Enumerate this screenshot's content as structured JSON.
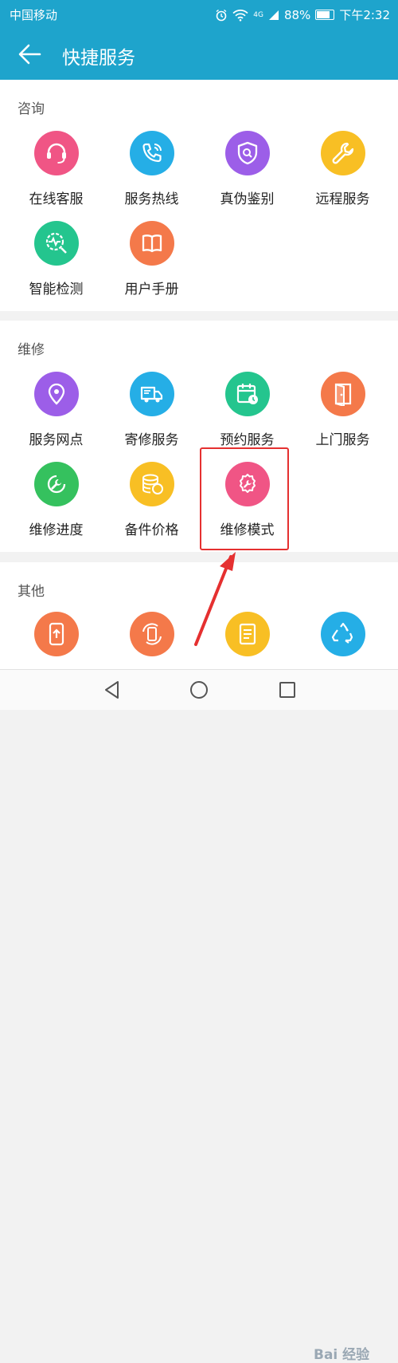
{
  "status_bar": {
    "carrier": "中国移动",
    "network": "4G",
    "battery": "88%",
    "battery_level": 0.88,
    "time": "下午2:32"
  },
  "header": {
    "title": "快捷服务"
  },
  "sections": [
    {
      "title": "咨询",
      "items": [
        {
          "label": "在线客服",
          "icon": "headset-icon",
          "color": "#f05585"
        },
        {
          "label": "服务热线",
          "icon": "phone-icon",
          "color": "#25aee6"
        },
        {
          "label": "真伪鉴别",
          "icon": "shield-search-icon",
          "color": "#9c5ee8"
        },
        {
          "label": "远程服务",
          "icon": "wrench-icon",
          "color": "#f8bf24"
        },
        {
          "label": "智能检测",
          "icon": "detect-icon",
          "color": "#24c58e"
        },
        {
          "label": "用户手册",
          "icon": "book-icon",
          "color": "#f4794a"
        }
      ]
    },
    {
      "title": "维修",
      "items": [
        {
          "label": "服务网点",
          "icon": "location-icon",
          "color": "#9c5ee8"
        },
        {
          "label": "寄修服务",
          "icon": "truck-icon",
          "color": "#25aee6"
        },
        {
          "label": "预约服务",
          "icon": "calendar-icon",
          "color": "#24c58e"
        },
        {
          "label": "上门服务",
          "icon": "door-icon",
          "color": "#f4794a"
        },
        {
          "label": "维修进度",
          "icon": "progress-wrench-icon",
          "color": "#35c15e"
        },
        {
          "label": "备件价格",
          "icon": "coins-icon",
          "color": "#f8bf24"
        },
        {
          "label": "维修模式",
          "icon": "gear-wrench-icon",
          "color": "#f05585"
        }
      ]
    },
    {
      "title": "其他",
      "items": [
        {
          "label": "",
          "icon": "phone-upload-icon",
          "color": "#f4794a"
        },
        {
          "label": "",
          "icon": "phone-rotate-icon",
          "color": "#f4794a"
        },
        {
          "label": "",
          "icon": "document-icon",
          "color": "#f8bf24"
        },
        {
          "label": "",
          "icon": "recycle-icon",
          "color": "#25aee6"
        }
      ]
    }
  ],
  "nav_bar": {
    "items": [
      "back-triangle-icon",
      "home-circle-icon",
      "recent-square-icon"
    ]
  },
  "watermark": {
    "text": "Bai 经验"
  }
}
